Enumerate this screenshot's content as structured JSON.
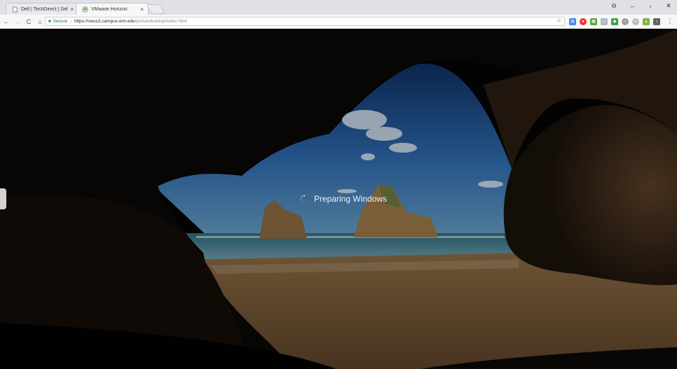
{
  "tabs": [
    {
      "title": "Dell | TechDirect | Self-Di",
      "icon": "page-icon",
      "close": "×"
    },
    {
      "title": "VMware Horizon",
      "icon": "vmware-horizon-icon",
      "close": "×"
    }
  ],
  "window_controls": {
    "profile": "⊖",
    "minimize": "–",
    "maximize": "▫",
    "close": "✕"
  },
  "toolbar": {
    "back": "←",
    "forward": "→",
    "reload": "C",
    "home": "⌂",
    "secure_label": "Secure",
    "url_host": "https://vwss3.campus.wm.edu",
    "url_path": "/portal/desktop/index.html",
    "bookmark": "☆",
    "menu": "⋮"
  },
  "extensions": [
    {
      "name": "extension-icon-1",
      "color": "#4285f4",
      "glyph": "▤"
    },
    {
      "name": "extension-icon-2",
      "color": "#e53935",
      "glyph": "●"
    },
    {
      "name": "extension-icon-3",
      "color": "#5aa543",
      "glyph": "▦"
    },
    {
      "name": "extension-icon-4",
      "color": "#b0b7c3",
      "glyph": "▭"
    },
    {
      "name": "extension-icon-5",
      "color": "#43a047",
      "glyph": "◆"
    },
    {
      "name": "extension-icon-6",
      "color": "#9e9e9e",
      "glyph": "○"
    },
    {
      "name": "extension-icon-7",
      "color": "#bdbdbd",
      "glyph": "◐"
    },
    {
      "name": "extension-icon-8",
      "color": "#7cb342",
      "glyph": "▴"
    },
    {
      "name": "extension-icon-9",
      "color": "#616161",
      "glyph": "ι"
    }
  ],
  "session": {
    "status_text": "Preparing Windows"
  },
  "colors": {
    "sky": "#2d63a8",
    "sea": "#4f8fa8",
    "sand": "#c79a5e",
    "rock": "#3a2a1c"
  }
}
